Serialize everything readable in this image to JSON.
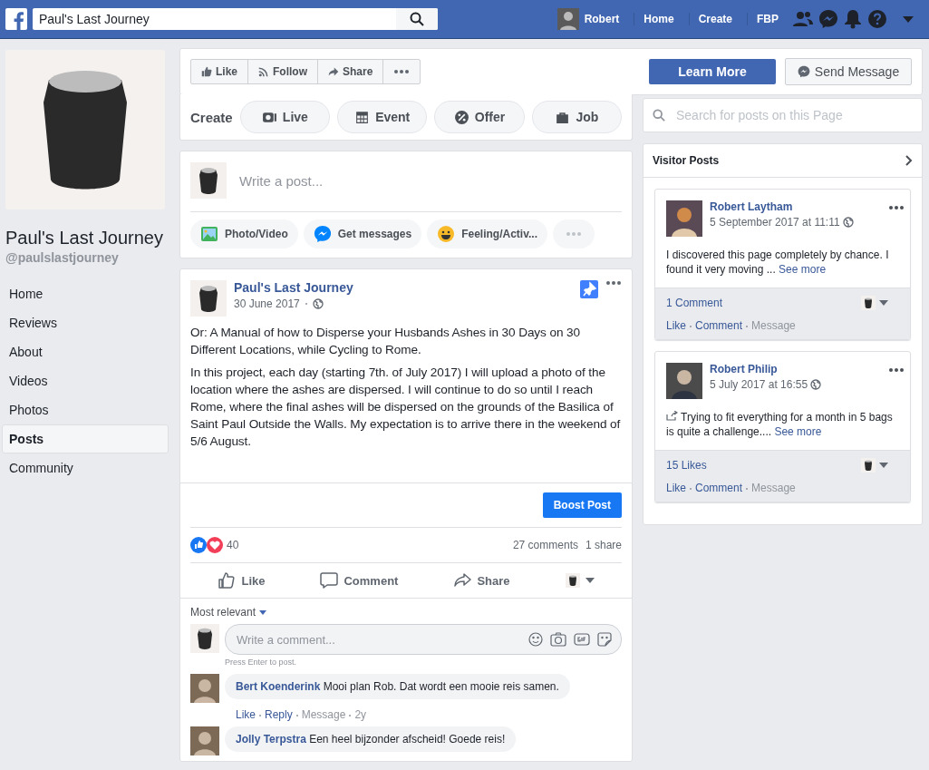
{
  "topbar": {
    "search": {
      "value": "Paul's Last Journey"
    },
    "user": "Robert",
    "links": [
      "Home",
      "Create",
      "FBP"
    ]
  },
  "page": {
    "name": "Paul's Last Journey",
    "handle": "@paulslastjourney"
  },
  "nav": [
    {
      "label": "Home",
      "selected": false
    },
    {
      "label": "Reviews",
      "selected": false
    },
    {
      "label": "About",
      "selected": false
    },
    {
      "label": "Videos",
      "selected": false
    },
    {
      "label": "Photos",
      "selected": false
    },
    {
      "label": "Posts",
      "selected": true
    },
    {
      "label": "Community",
      "selected": false
    }
  ],
  "page_actions": [
    {
      "kind": "like",
      "label": "Like"
    },
    {
      "kind": "follow",
      "label": "Follow"
    },
    {
      "kind": "share",
      "label": "Share"
    },
    {
      "kind": "more"
    }
  ],
  "cta": {
    "primary": "Learn More",
    "secondary": "Send Message"
  },
  "create": {
    "label": "Create",
    "items": [
      {
        "kind": "live",
        "label": "Live"
      },
      {
        "kind": "event",
        "label": "Event"
      },
      {
        "kind": "offer",
        "label": "Offer"
      },
      {
        "kind": "job",
        "label": "Job"
      }
    ]
  },
  "composer": {
    "placeholder": "Write a post...",
    "actions": [
      {
        "kind": "photo",
        "label": "Photo/Video"
      },
      {
        "kind": "messages",
        "label": "Get messages"
      },
      {
        "kind": "feeling",
        "label": "Feeling/Activ..."
      },
      {
        "kind": "more"
      }
    ]
  },
  "post": {
    "author": "Paul's Last Journey",
    "date": "30 June 2017",
    "pinned": true,
    "paragraphs": [
      "Or: A Manual of how to Disperse your Husbands Ashes in 30 Days on 30 Different Locations, while Cycling to Rome.",
      "In this project, each day (starting 7th. of July 2017) I will upload a photo of the location where the ashes are dispersed. I will continue to do so until I reach Rome, where the final ashes will be dispersed on the grounds of the Basilica of Saint Paul Outside the Walls. My expectation is to arrive there in the weekend of 5/6 August."
    ],
    "boost": "Boost Post",
    "reaction_count": "40",
    "comments_count": "27 comments",
    "shares_count": "1 share",
    "actions": [
      {
        "kind": "like",
        "label": "Like"
      },
      {
        "kind": "comment",
        "label": "Comment"
      },
      {
        "kind": "share",
        "label": "Share"
      }
    ],
    "sort": "Most relevant",
    "comment_placeholder": "Write a comment...",
    "hint": "Press Enter to post.",
    "comments": [
      {
        "author": "Bert Koenderink",
        "text": "Mooi plan Rob. Dat wordt een mooie reis samen.",
        "meta": [
          {
            "kind": "link",
            "label": "Like"
          },
          {
            "kind": "link",
            "label": "Reply"
          },
          {
            "kind": "muted",
            "label": "Message"
          },
          {
            "kind": "muted",
            "label": "2y"
          }
        ]
      },
      {
        "author": "Jolly Terpstra",
        "text": "Een heel bijzonder afscheid! Goede reis!"
      }
    ]
  },
  "right": {
    "search": {
      "placeholder": "Search for posts on this Page"
    },
    "title": "Visitor Posts",
    "posts": [
      {
        "author": "Robert Laytham",
        "date": "5 September 2017 at 11:11",
        "shared": false,
        "text": "I discovered this page completely by chance. I found it very moving ...",
        "see_more": "See more",
        "stat": "1 Comment",
        "actions": [
          {
            "kind": "link",
            "label": "Like"
          },
          {
            "kind": "link",
            "label": "Comment"
          },
          {
            "kind": "muted",
            "label": "Message"
          }
        ]
      },
      {
        "author": "Robert Philip",
        "date": "5 July 2017 at 16:55",
        "shared": true,
        "text": "Trying to fit everything for a month in 5 bags is quite a challenge....",
        "see_more": "See more",
        "stat": "15 Likes",
        "actions": [
          {
            "kind": "link",
            "label": "Like"
          },
          {
            "kind": "link",
            "label": "Comment"
          },
          {
            "kind": "muted",
            "label": "Message"
          }
        ]
      }
    ]
  }
}
